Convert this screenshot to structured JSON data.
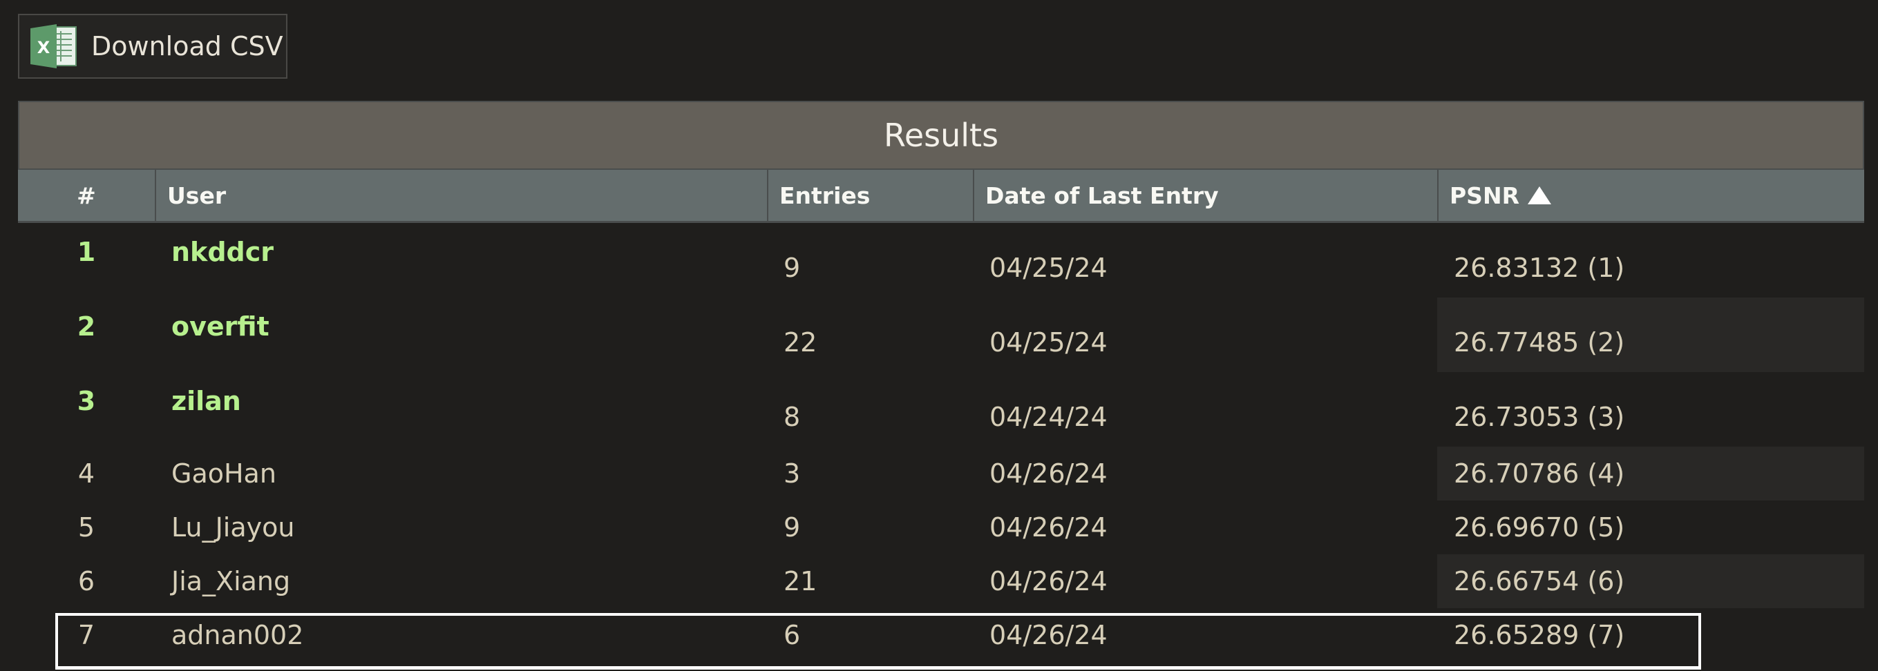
{
  "toolbar": {
    "download_label": "Download CSV",
    "icon": "excel-icon"
  },
  "table": {
    "title": "Results",
    "columns": [
      "#",
      "User",
      "Entries",
      "Date of Last Entry",
      "PSNR"
    ],
    "sort": {
      "column": "PSNR",
      "direction": "ascending-indicator"
    },
    "rows": [
      {
        "rank": "1",
        "user": "nkddcr",
        "entries": "9",
        "date": "04/25/24",
        "psnr": "26.83132 (1)"
      },
      {
        "rank": "2",
        "user": "overfit",
        "entries": "22",
        "date": "04/25/24",
        "psnr": "26.77485 (2)"
      },
      {
        "rank": "3",
        "user": "zilan",
        "entries": "8",
        "date": "04/24/24",
        "psnr": "26.73053 (3)"
      },
      {
        "rank": "4",
        "user": "GaoHan",
        "entries": "3",
        "date": "04/26/24",
        "psnr": "26.70786 (4)"
      },
      {
        "rank": "5",
        "user": "Lu_Jiayou",
        "entries": "9",
        "date": "04/26/24",
        "psnr": "26.69670 (5)"
      },
      {
        "rank": "6",
        "user": "Jia_Xiang",
        "entries": "21",
        "date": "04/26/24",
        "psnr": "26.66754 (6)"
      },
      {
        "rank": "7",
        "user": "adnan002",
        "entries": "6",
        "date": "04/26/24",
        "psnr": "26.65289 (7)"
      }
    ],
    "highlighted_row": "7"
  },
  "colors": {
    "background": "#1f1e1c",
    "title_bar": "#646059",
    "header_bar": "#646d6d",
    "top_rank_text": "#b7f08e",
    "body_text": "#d7cfb8",
    "highlight_border": "#ffffff"
  }
}
